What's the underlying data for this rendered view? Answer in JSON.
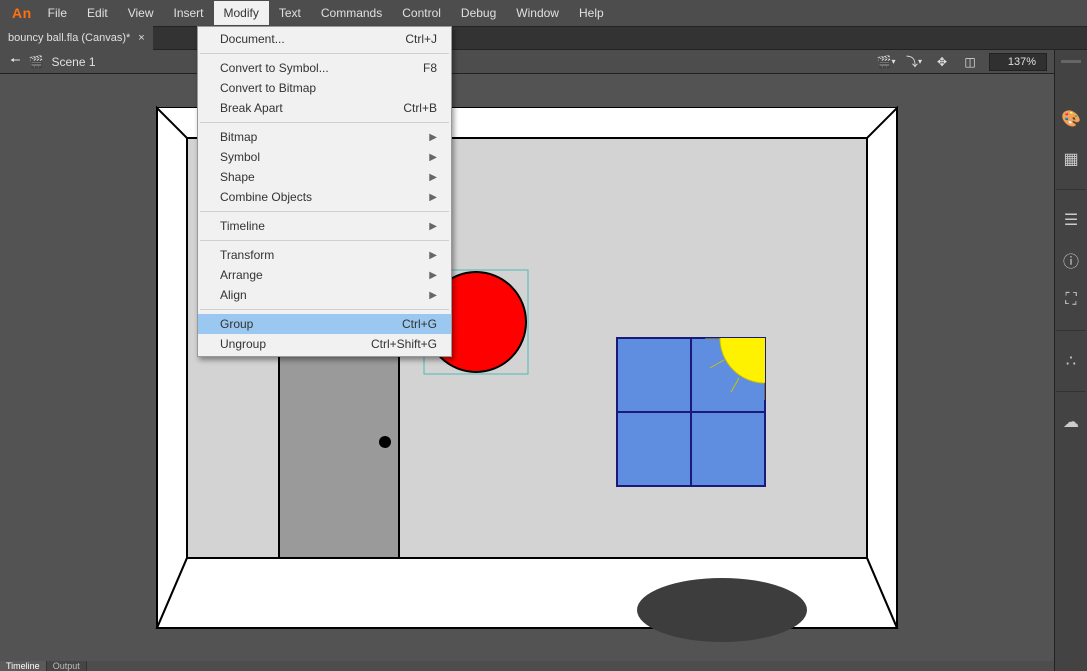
{
  "app_logo": "An",
  "menubar": [
    "File",
    "Edit",
    "View",
    "Insert",
    "Modify",
    "Text",
    "Commands",
    "Control",
    "Debug",
    "Window",
    "Help"
  ],
  "active_menu": "Modify",
  "tab": {
    "name": "bouncy ball.fla (Canvas)*",
    "close": "×"
  },
  "scene": {
    "back": "🠔",
    "icon": "🎬",
    "name": "Scene 1"
  },
  "zoom": "137%",
  "dropdown": {
    "groups": [
      [
        {
          "label": "Document...",
          "shortcut": "Ctrl+J"
        }
      ],
      [
        {
          "label": "Convert to Symbol...",
          "shortcut": "F8"
        },
        {
          "label": "Convert to Bitmap"
        },
        {
          "label": "Break Apart",
          "shortcut": "Ctrl+B"
        }
      ],
      [
        {
          "label": "Bitmap",
          "submenu": true
        },
        {
          "label": "Symbol",
          "submenu": true
        },
        {
          "label": "Shape",
          "submenu": true
        },
        {
          "label": "Combine Objects",
          "submenu": true
        }
      ],
      [
        {
          "label": "Timeline",
          "submenu": true
        }
      ],
      [
        {
          "label": "Transform",
          "submenu": true
        },
        {
          "label": "Arrange",
          "submenu": true
        },
        {
          "label": "Align",
          "submenu": true
        }
      ],
      [
        {
          "label": "Group",
          "shortcut": "Ctrl+G",
          "highlight": true
        },
        {
          "label": "Ungroup",
          "shortcut": "Ctrl+Shift+G"
        }
      ]
    ]
  },
  "bottom_tabs": [
    "Timeline",
    "Output"
  ]
}
